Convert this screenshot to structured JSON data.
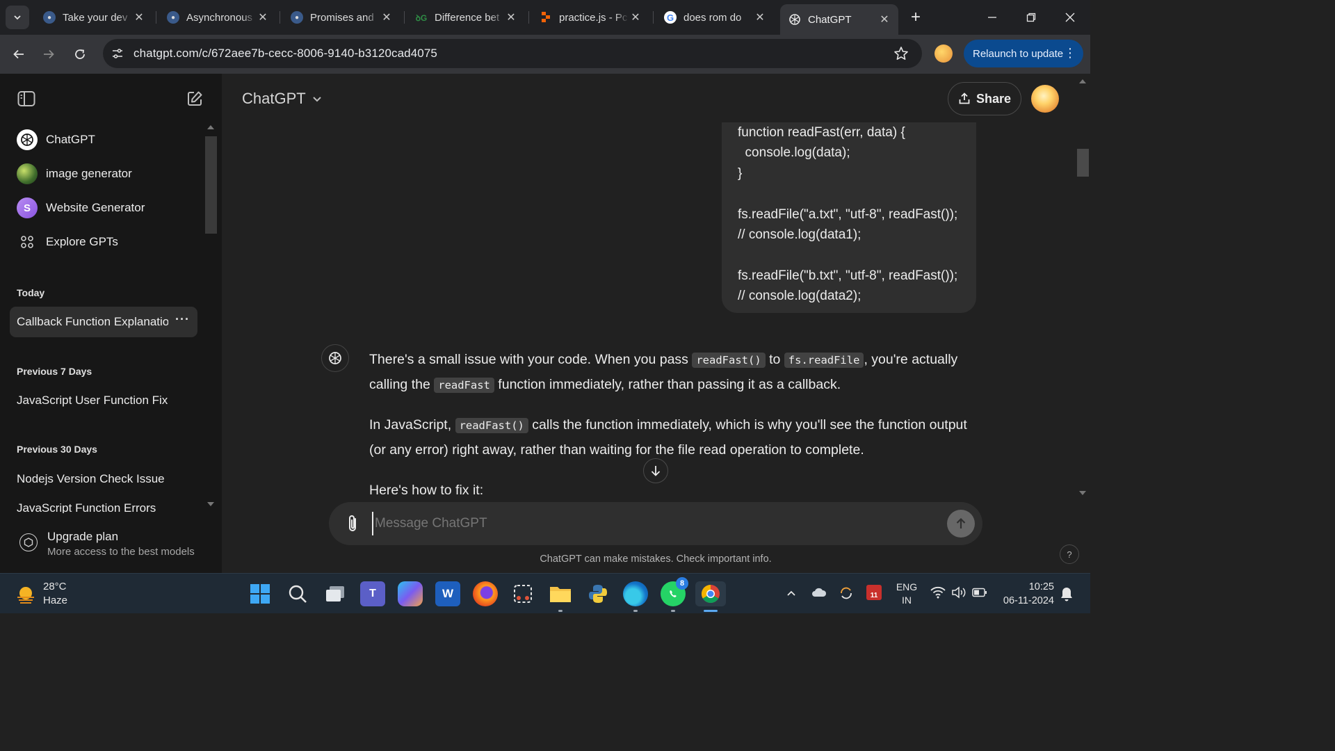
{
  "browser": {
    "tabs": [
      {
        "title": "Take your dev",
        "favicon": "avatar-favicon"
      },
      {
        "title": "Asynchronous",
        "favicon": "avatar-favicon"
      },
      {
        "title": "Promises and",
        "favicon": "avatar-favicon"
      },
      {
        "title": "Difference bet",
        "favicon": "gfg-favicon"
      },
      {
        "title": "practice.js - Pc",
        "favicon": "replit-favicon"
      },
      {
        "title": "does rom do",
        "favicon": "google-favicon"
      },
      {
        "title": "ChatGPT",
        "favicon": "chatgpt-favicon"
      }
    ],
    "url": "chatgpt.com/c/672aee7b-cecc-8006-9140-b3120cad4075",
    "relaunch_label": "Relaunch to update"
  },
  "sidebar": {
    "gpts": [
      {
        "label": "ChatGPT",
        "icon": "chatgpt-logo-icon"
      },
      {
        "label": "image generator",
        "icon": "image-generator-avatar"
      },
      {
        "label": "Website Generator",
        "icon": "website-generator-avatar"
      },
      {
        "label": "Explore GPTs",
        "icon": "grid-icon"
      }
    ],
    "sections": [
      {
        "heading": "Today",
        "chats": [
          "Callback Function Explanatio"
        ]
      },
      {
        "heading": "Previous 7 Days",
        "chats": [
          "JavaScript User Function Fix"
        ]
      },
      {
        "heading": "Previous 30 Days",
        "chats": [
          "Nodejs Version Check Issue",
          "JavaScript Function Errors"
        ]
      }
    ],
    "upgrade": {
      "title": "Upgrade plan",
      "subtitle": "More access to the best models"
    }
  },
  "header": {
    "model_name": "ChatGPT",
    "share_label": "Share"
  },
  "conversation": {
    "user_code": [
      "function readFast(err, data) {",
      "  console.log(data);",
      "}",
      "",
      "fs.readFile(\"a.txt\", \"utf-8\", readFast());",
      "// console.log(data1);",
      "",
      "fs.readFile(\"b.txt\", \"utf-8\", readFast());",
      "// console.log(data2);"
    ],
    "reply": {
      "p1_a": "There's a small issue with your code. When you pass ",
      "p1_code1": "readFast()",
      "p1_b": " to ",
      "p1_code2": "fs.readFile",
      "p1_c": ", you're actually calling the ",
      "p1_code3": "readFast",
      "p1_d": " function immediately, rather than passing it as a callback.",
      "p2_a": "In JavaScript, ",
      "p2_code1": "readFast()",
      "p2_b": " calls the function immediately, which is why you'll see the function output (or any error) right away, rather than waiting for the file read operation to complete.",
      "p3": "Here's how to fix it:"
    }
  },
  "composer": {
    "placeholder": "Message ChatGPT",
    "disclaimer": "ChatGPT can make mistakes. Check important info.",
    "help": "?"
  },
  "taskbar": {
    "weather_temp": "28°C",
    "weather_desc": "Haze",
    "apps": [
      "windows-start",
      "search",
      "task-view",
      "teams",
      "copilot",
      "word",
      "firefox",
      "snipping-tool",
      "file-explorer",
      "python",
      "edge",
      "whatsapp",
      "chrome"
    ],
    "whatsapp_badge": "8",
    "calendar_badge": "11",
    "lang_line1": "ENG",
    "lang_line2": "IN",
    "time": "10:25",
    "date": "06-11-2024"
  }
}
